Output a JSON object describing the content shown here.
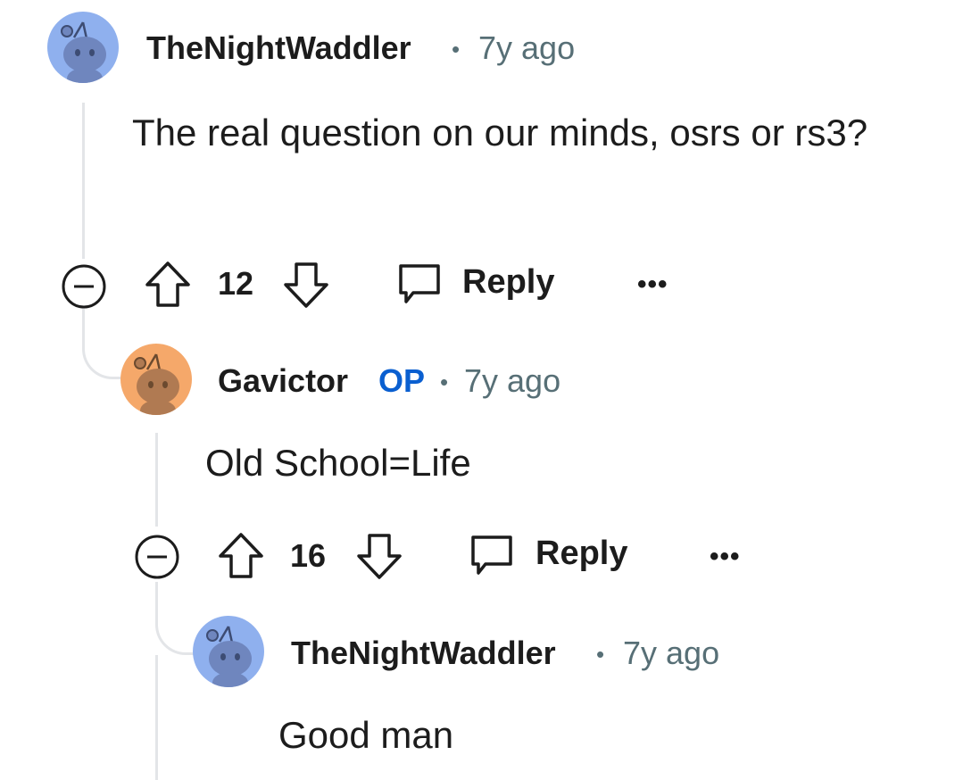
{
  "comments": [
    {
      "username": "TheNightWaddler",
      "separator": "•",
      "time": "7y ago",
      "body": "The real question on our minds, osrs or rs3?",
      "votes": "12",
      "reply_label": "Reply",
      "more_label": "•••",
      "avatar_color": "#8fb0ee",
      "avatar_icon": "snoo-avatar-icon"
    },
    {
      "username": "Gavictor",
      "op_badge": "OP",
      "separator": "•",
      "time": "7y ago",
      "body": "Old School=Life",
      "votes": "16",
      "reply_label": "Reply",
      "more_label": "•••",
      "avatar_color": "#f5a86a",
      "avatar_icon": "snoo-avatar-icon"
    },
    {
      "username": "TheNightWaddler",
      "separator": "•",
      "time": "7y ago",
      "body": "Good man",
      "avatar_color": "#8fb0ee",
      "avatar_icon": "snoo-avatar-icon"
    }
  ],
  "colors": {
    "op_badge": "#0a5fd0",
    "meta_text": "#576f76",
    "thread_line": "#e3e5e8"
  }
}
